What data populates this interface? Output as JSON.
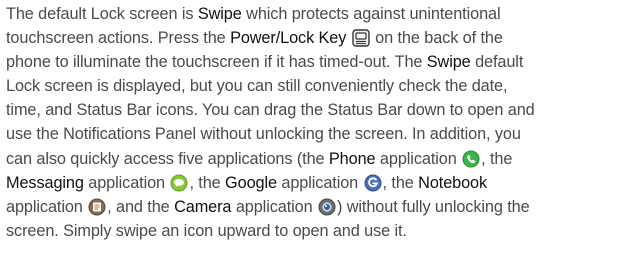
{
  "paragraph": {
    "t1": "The default Lock screen is ",
    "swipe1": "Swipe",
    "t2": " which protects against unintentional",
    "t3": "touchscreen actions. Press the ",
    "power_key": "Power/Lock Key",
    "t4": " on the back of the",
    "t5": "phone to illuminate the touchscreen if it has timed-out. The ",
    "swipe2": "Swipe",
    "t6": " default",
    "t7": "Lock screen is displayed, but you can still conveniently check the date,",
    "t8": "time, and Status Bar icons. You can drag the Status Bar down to open and",
    "t9": "use the Notifications Panel without unlocking the screen. In addition, you",
    "t10": "can also quickly access five applications (the ",
    "phone": "Phone",
    "t11": " application ",
    "t12": ", the",
    "messaging": "Messaging",
    "t13": " application ",
    "t14": ", the ",
    "google": "Google",
    "t15": " application ",
    "t16": ", the ",
    "notebook": "Notebook",
    "t17": "application ",
    "t18": ", and the ",
    "camera": "Camera",
    "t19": " application ",
    "t20": ") without fully unlocking the",
    "t21": "screen. Simply swipe an icon upward to open and use it."
  },
  "icons": {
    "power_key": "power-lock-key-icon",
    "phone": "phone-app-icon",
    "messaging": "messaging-app-icon",
    "google": "google-app-icon",
    "notebook": "notebook-app-icon",
    "camera": "camera-app-icon"
  },
  "colors": {
    "body_text": "#4a4a4a",
    "emphasis_text": "#111111",
    "phone_green": "#39b54a",
    "messaging_green": "#8cc63f",
    "google_blue": "#4a6fb5",
    "notebook_brown": "#8a6a4a",
    "camera_gray": "#6d6e71"
  }
}
